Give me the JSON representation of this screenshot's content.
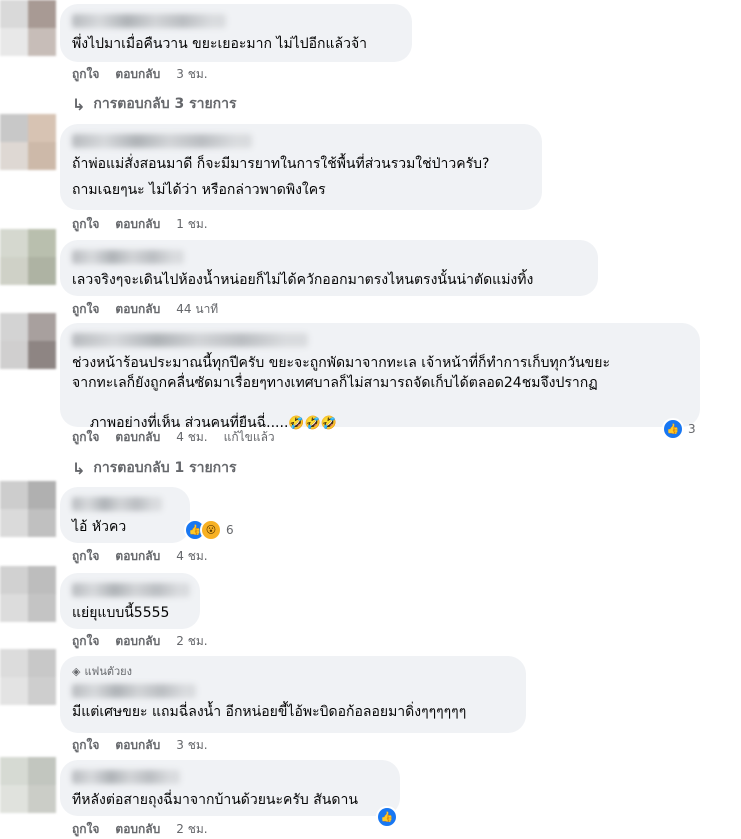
{
  "comments": [
    {
      "text_lines": [
        "พึ่งไปมาเมื่อคืนวาน ขยะเยอะมาก ไม่ไปอีกแล้วจ้า"
      ],
      "actions": {
        "like": "ถูกใจ",
        "reply": "ตอบกลับ",
        "time": "3 ชม."
      },
      "replies_label": "การตอบกลับ 3 รายการ"
    },
    {
      "text_lines": [
        "ถ้าพ่อแม่สั่งสอนมาดี ก็จะมีมารยาทในการใช้พื้นที่ส่วนรวมใช่ป่าวครับ?",
        "ถามเฉยๆนะ ไม่ได้ว่า หรือกล่าวพาดพิงใคร"
      ],
      "actions": {
        "like": "ถูกใจ",
        "reply": "ตอบกลับ",
        "time": "1 ชม."
      }
    },
    {
      "text_lines": [
        "เลวจริงๆจะเดินไปห้องน้ำหน่อยก็ไม่ได้ควักออกมาตรงไหนตรงนั้นน่าตัดแม่งทิ้ง"
      ],
      "actions": {
        "like": "ถูกใจ",
        "reply": "ตอบกลับ",
        "time": "44 นาที"
      }
    },
    {
      "text_lines": [
        "ช่วงหน้าร้อนประมาณนี้ทุกปีครับ ขยะจะถูกพัดมาจากทะเล เจ้าหน้าที่ก็ทำการเก็บทุกวันขยะ",
        "จากทะเลก็ยังถูกคลื่นซัดมาเรื่อยๆทางเทศบาลก็ไม่สามารถจัดเก็บได้ตลอด24ชมจึงปรากฏ",
        "ภาพอย่างที่เห็น ส่วนคนที่ยืนฉี่....."
      ],
      "emoji_suffix": "🤣🤣🤣",
      "actions": {
        "like": "ถูกใจ",
        "reply": "ตอบกลับ",
        "time": "4 ชม.",
        "edited": "แก้ไขแล้ว"
      },
      "reaction_count": "3",
      "replies_label": "การตอบกลับ 1 รายการ"
    },
    {
      "text_lines": [
        "ไอ้ หัวคว"
      ],
      "actions": {
        "like": "ถูกใจ",
        "reply": "ตอบกลับ",
        "time": "4 ชม."
      },
      "reaction_count": "6"
    },
    {
      "text_lines": [
        "แย่ยุแบบนี้5555"
      ],
      "actions": {
        "like": "ถูกใจ",
        "reply": "ตอบกลับ",
        "time": "2 ชม."
      }
    },
    {
      "badge": "แฟนตัวยง",
      "text_lines": [
        "มีแต่เศษขยะ แถมฉี่ลงน้ำ อีกหน่อยขี้ไอ้พะบิดอก้อลอยมาดิ่งๆๆๆๆๆๆ"
      ],
      "actions": {
        "like": "ถูกใจ",
        "reply": "ตอบกลับ",
        "time": "3 ชม."
      }
    },
    {
      "text_lines": [
        "ทีหลังต่อสายถุงฉี่มาจากบ้านด้วยนะครับ สันดาน"
      ],
      "actions": {
        "like": "ถูกใจ",
        "reply": "ตอบกลับ",
        "time": "2 ชม."
      }
    }
  ],
  "colors": {
    "bubble": "#f0f2f5",
    "meta": "#65676b",
    "like": "#1877f2"
  },
  "icons": {
    "like": "thumbs-up-icon",
    "wow": "wow-icon",
    "reply": "reply-arrow-icon",
    "badge": "diamond-icon"
  }
}
